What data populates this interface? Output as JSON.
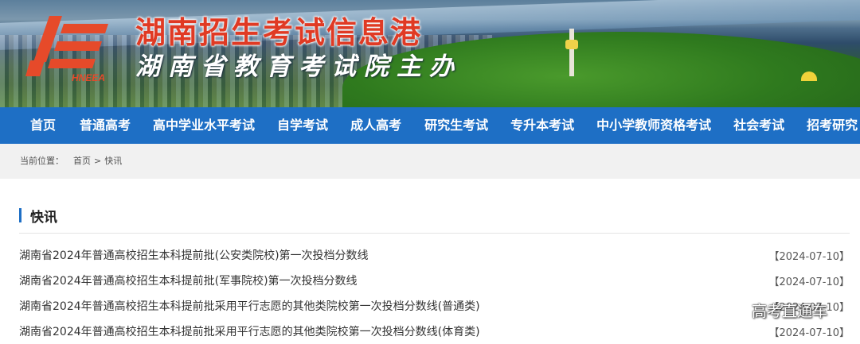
{
  "header": {
    "title": "湖南招生考试信息港",
    "subtitle": "湖南省教育考试院主办",
    "logo_mark_text": "HNEEA"
  },
  "nav": {
    "items": [
      "首页",
      "普通高考",
      "高中学业水平考试",
      "自学考试",
      "成人高考",
      "研究生考试",
      "专升本考试",
      "中小学教师资格考试",
      "社会考试",
      "招考研究"
    ]
  },
  "breadcrumb": {
    "label": "当前位置：",
    "home": "首页",
    "separator": ">",
    "current": "快讯"
  },
  "section": {
    "title": "快讯"
  },
  "news": [
    {
      "title": "湖南省2024年普通高校招生本科提前批(公安类院校)第一次投档分数线",
      "date": "【2024-07-10】"
    },
    {
      "title": "湖南省2024年普通高校招生本科提前批(军事院校)第一次投档分数线",
      "date": "【2024-07-10】"
    },
    {
      "title": "湖南省2024年普通高校招生本科提前批采用平行志愿的其他类院校第一次投档分数线(普通类)",
      "date": "【2024-07-10】"
    },
    {
      "title": "湖南省2024年普通高校招生本科提前批采用平行志愿的其他类院校第一次投档分数线(体育类)",
      "date": "【2024-07-10】"
    }
  ],
  "watermark": "高考直通车",
  "colors": {
    "nav_bg": "#1e6fc5",
    "title_red": "#e03a24",
    "accent_bar": "#1e6fc5"
  }
}
